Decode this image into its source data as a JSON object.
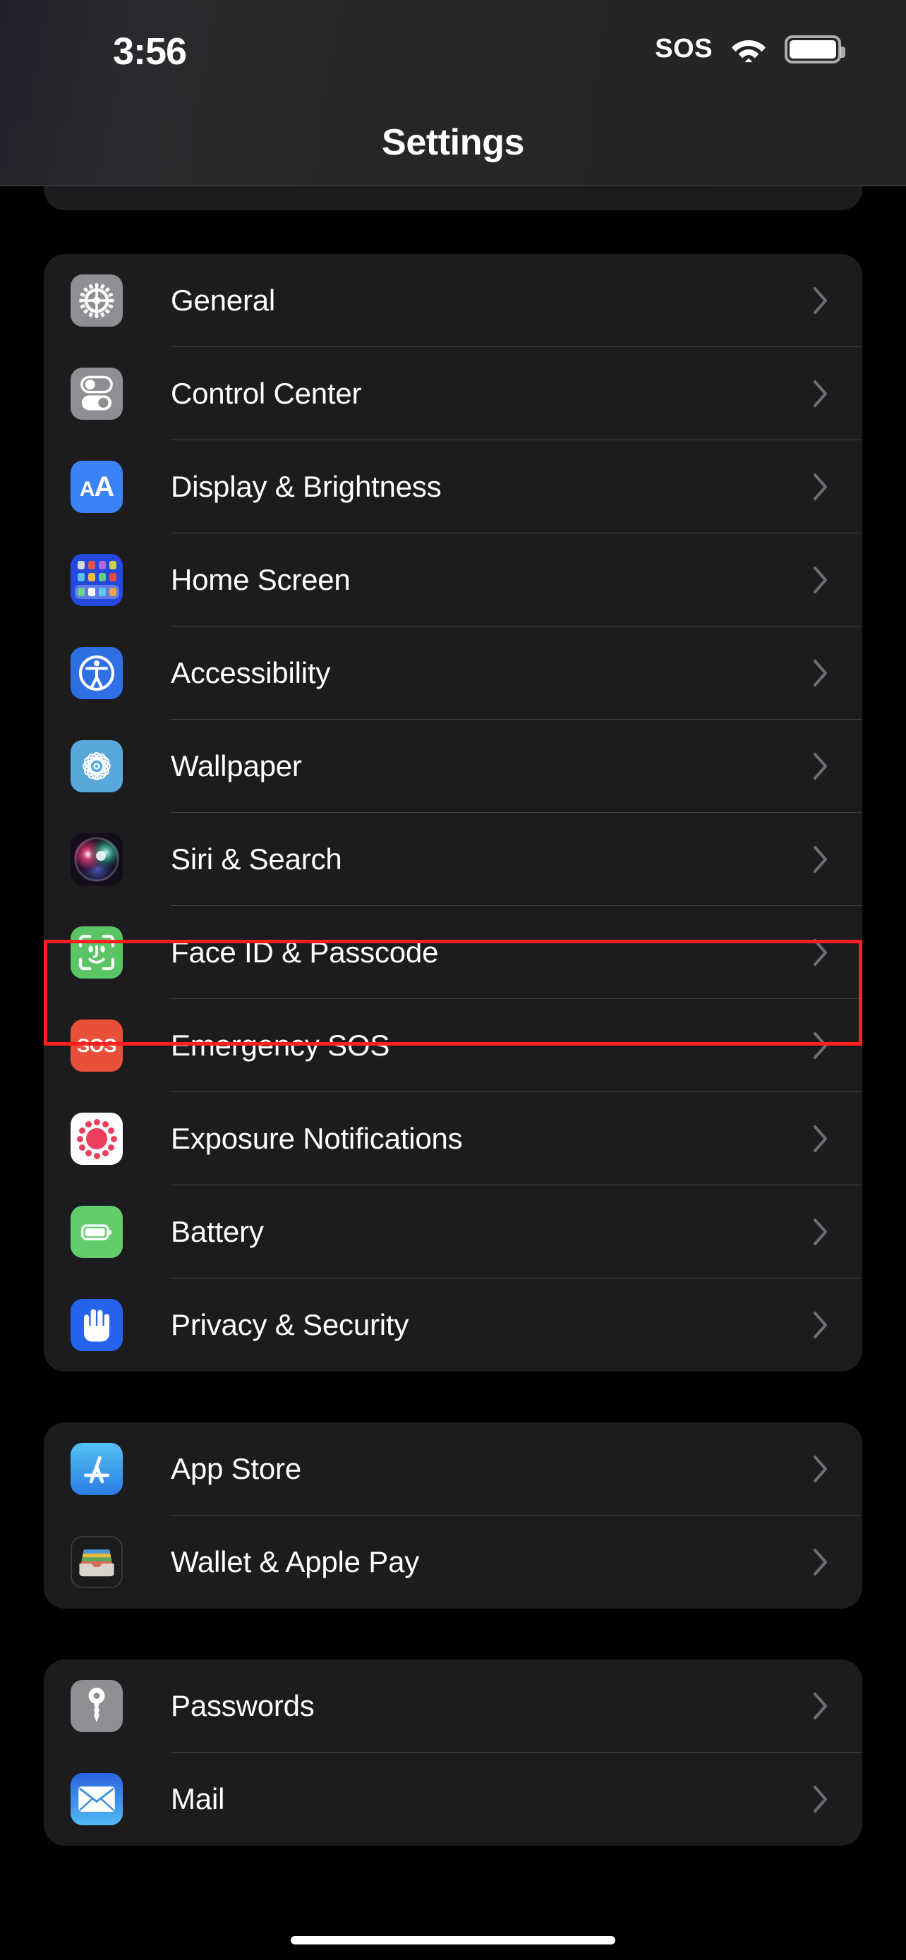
{
  "status_bar": {
    "time": "3:56",
    "sos_label": "SOS",
    "wifi_icon": "wifi-icon",
    "battery_icon": "battery-full-icon"
  },
  "header": {
    "title": "Settings"
  },
  "highlight": {
    "target_label": "Face ID & Passcode",
    "color": "#ff1f1f"
  },
  "groups": [
    {
      "id": "group-main",
      "items": [
        {
          "label": "General",
          "icon": "gear-icon",
          "icon_class": "ic-general",
          "chevron": "chevron-right-icon"
        },
        {
          "label": "Control Center",
          "icon": "toggles-icon",
          "icon_class": "ic-control",
          "chevron": "chevron-right-icon"
        },
        {
          "label": "Display & Brightness",
          "icon": "text-size-aa-icon",
          "icon_class": "ic-display",
          "chevron": "chevron-right-icon"
        },
        {
          "label": "Home Screen",
          "icon": "app-grid-icon",
          "icon_class": "ic-home",
          "chevron": "chevron-right-icon"
        },
        {
          "label": "Accessibility",
          "icon": "accessibility-icon",
          "icon_class": "ic-access",
          "chevron": "chevron-right-icon"
        },
        {
          "label": "Wallpaper",
          "icon": "flower-pattern-icon",
          "icon_class": "ic-wall",
          "chevron": "chevron-right-icon"
        },
        {
          "label": "Siri & Search",
          "icon": "siri-orb-icon",
          "icon_class": "ic-siri",
          "chevron": "chevron-right-icon"
        },
        {
          "label": "Face ID & Passcode",
          "icon": "face-id-icon",
          "icon_class": "ic-faceid",
          "chevron": "chevron-right-icon"
        },
        {
          "label": "Emergency SOS",
          "icon": "sos-icon",
          "icon_class": "ic-sos",
          "chevron": "chevron-right-icon"
        },
        {
          "label": "Exposure Notifications",
          "icon": "exposure-dots-icon",
          "icon_class": "ic-exp",
          "chevron": "chevron-right-icon"
        },
        {
          "label": "Battery",
          "icon": "battery-icon",
          "icon_class": "ic-batt",
          "chevron": "chevron-right-icon"
        },
        {
          "label": "Privacy & Security",
          "icon": "hand-raised-icon",
          "icon_class": "ic-priv",
          "chevron": "chevron-right-icon"
        }
      ]
    },
    {
      "id": "group-store",
      "items": [
        {
          "label": "App Store",
          "icon": "app-store-icon",
          "icon_class": "ic-appst",
          "chevron": "chevron-right-icon"
        },
        {
          "label": "Wallet & Apple Pay",
          "icon": "wallet-icon",
          "icon_class": "ic-wallet",
          "chevron": "chevron-right-icon"
        }
      ]
    },
    {
      "id": "group-accounts",
      "items": [
        {
          "label": "Passwords",
          "icon": "key-icon",
          "icon_class": "ic-pass",
          "chevron": "chevron-right-icon"
        },
        {
          "label": "Mail",
          "icon": "envelope-icon",
          "icon_class": "ic-mail",
          "chevron": "chevron-right-icon"
        }
      ]
    }
  ]
}
